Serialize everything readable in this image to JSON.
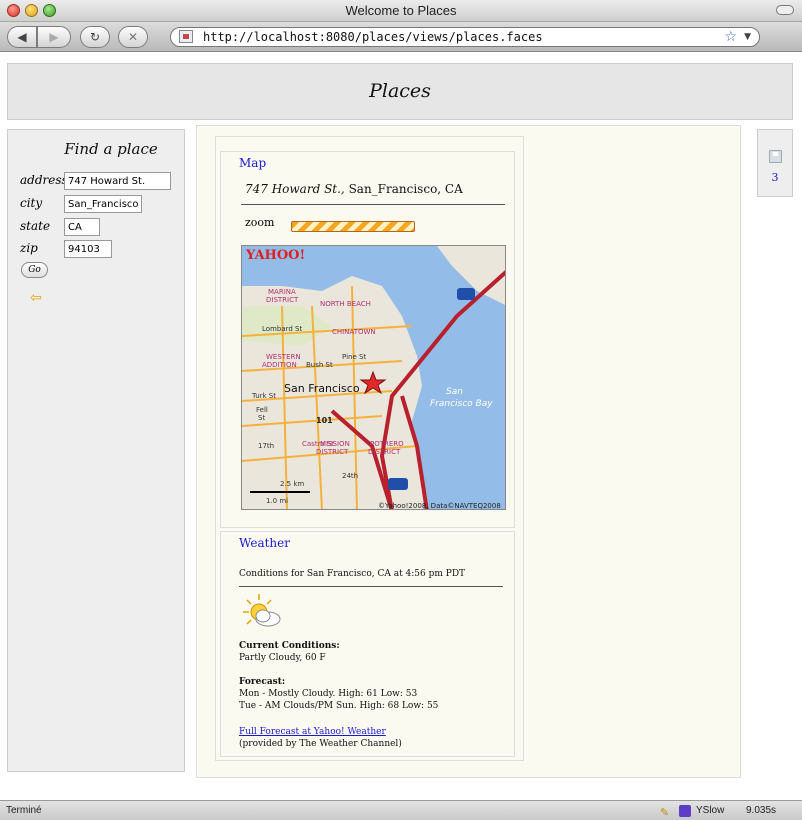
{
  "window": {
    "title": "Welcome to Places"
  },
  "toolbar": {
    "back": "◀",
    "forward": "▶",
    "reload": "↻",
    "stop": "✕",
    "url": "http://localhost:8080/places/views/places.faces"
  },
  "header": {
    "title": "Places"
  },
  "form": {
    "title": "Find a place",
    "fields": [
      {
        "label": "address",
        "value": "747 Howard St."
      },
      {
        "label": "city",
        "value": "San_Francisco"
      },
      {
        "label": "state",
        "value": "CA"
      },
      {
        "label": "zip",
        "value": "94103"
      }
    ],
    "go_label": "Go"
  },
  "map": {
    "title": "Map",
    "address_street": "747 Howard St.,",
    "address_city": "San_Francisco, CA",
    "zoom_label": "zoom",
    "labels": {
      "brand": "YAHOO!",
      "marina": "MARINA",
      "district": "DISTRICT",
      "north_beach": "NORTH BEACH",
      "lombard": "Lombard St",
      "chinatown": "CHINATOWN",
      "western": "WESTERN",
      "addition": "ADDITION",
      "bush": "Bush St",
      "pine": "Pine St",
      "turk": "Turk St",
      "sf": "San Francisco",
      "fell": "Fell",
      "st": "St",
      "hwy101": "101",
      "castro": "Castro St",
      "mission": "MISSION",
      "mission_district": "DISTRICT",
      "potrero": "POTRERO",
      "potrero_district": "DISTRICT",
      "st17": "17th",
      "st24": "24th",
      "bay1": "San",
      "bay2": "Francisco Bay",
      "i80": "80",
      "i280": "280",
      "km": "2.5 km",
      "mi": "1.0 mi",
      "copyright": "©Yahoo!2008, Data©NAVTEQ2008"
    }
  },
  "weather": {
    "title": "Weather",
    "conditions_header": "Conditions for San Francisco, CA at 4:56 pm PDT",
    "current_label": "Current Conditions:",
    "current_value": "Partly Cloudy, 60 F",
    "forecast_label": "Forecast:",
    "forecast_1": "Mon - Mostly Cloudy. High: 61 Low: 53",
    "forecast_2": "Tue - AM Clouds/PM Sun. High: 68 Low: 55",
    "link": "Full Forecast at Yahoo! Weather",
    "provider": "(provided by The Weather Channel)"
  },
  "sidebar_right": {
    "page_number": "3"
  },
  "status_bar": {
    "text": "Terminé",
    "yslow": "YSlow",
    "time": "9.035s"
  }
}
